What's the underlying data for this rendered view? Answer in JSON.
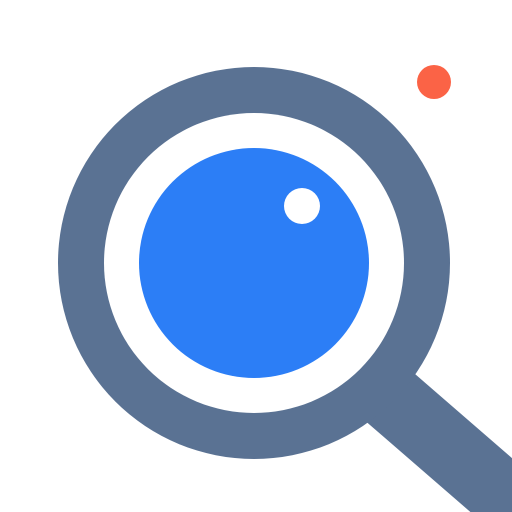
{
  "icon": {
    "name": "magnifier-search-icon",
    "colors": {
      "background": "#ffffff",
      "frame": "#5a7293",
      "lens_gap": "#ffffff",
      "lens": "#2c7ef6",
      "highlight": "#ffffff",
      "notification_dot": "#fb6346"
    },
    "notification_badge": {
      "visible": true
    }
  }
}
